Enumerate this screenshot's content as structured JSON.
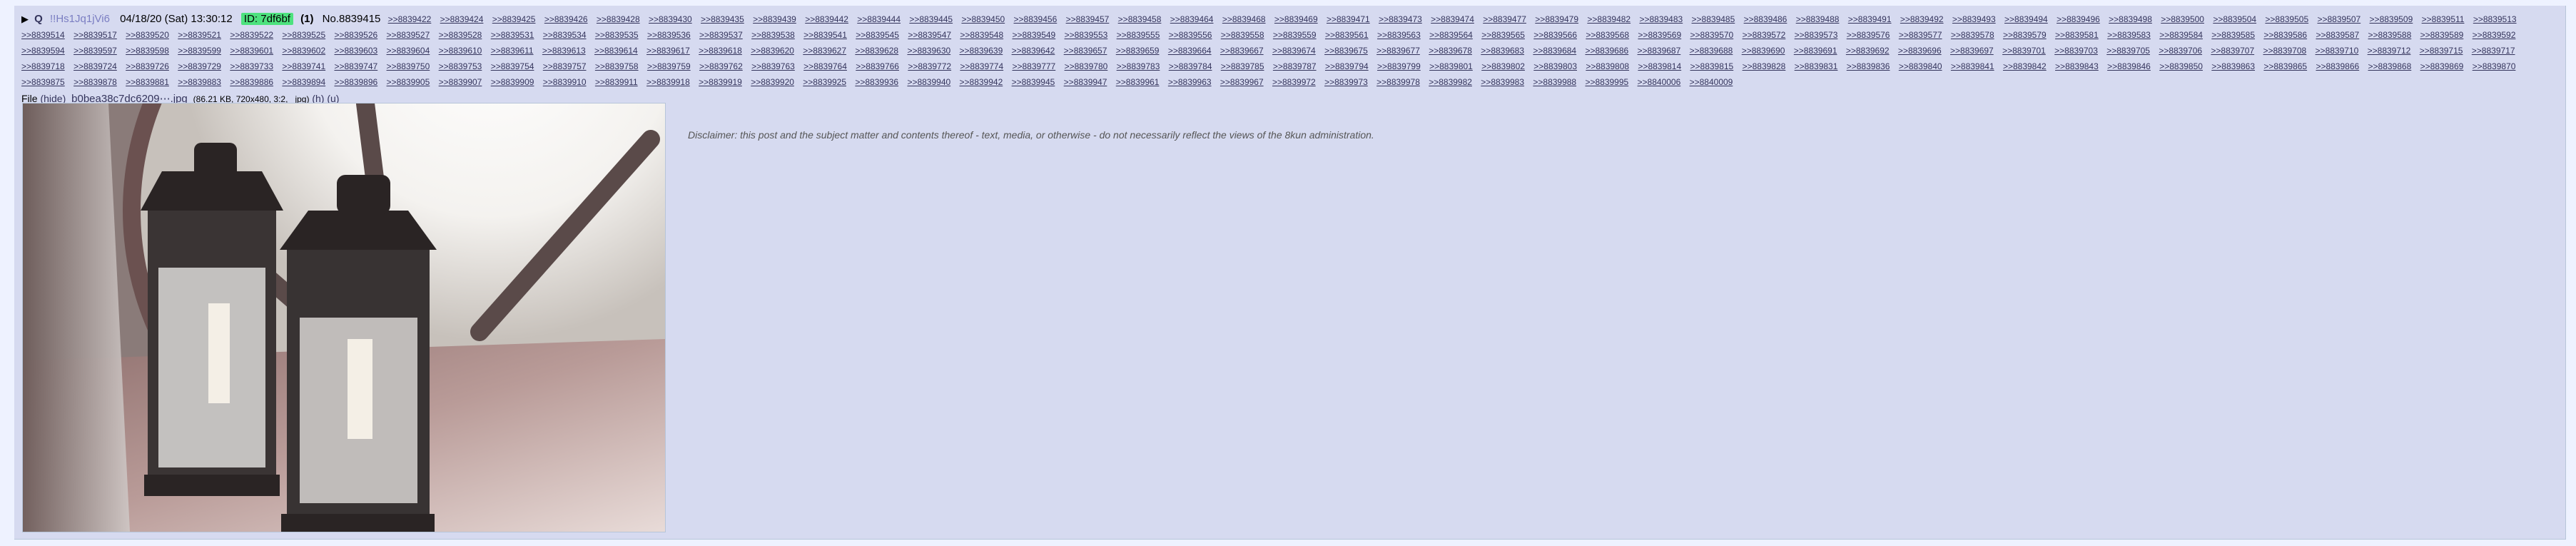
{
  "post": {
    "anchor": "Q",
    "tripcode": "!!Hs1Jq1jVi6",
    "date": "04/18/20 (Sat) 13:30:12",
    "id_label": "ID: 7df6bf",
    "post_count": "(1)",
    "post_no": "No.8839415",
    "replies": [
      ">>8839422",
      ">>8839424",
      ">>8839425",
      ">>8839426",
      ">>8839428",
      ">>8839430",
      ">>8839435",
      ">>8839439",
      ">>8839442",
      ">>8839444",
      ">>8839445",
      ">>8839450",
      ">>8839456",
      ">>8839457",
      ">>8839458",
      ">>8839464",
      ">>8839468",
      ">>8839469",
      ">>8839471",
      ">>8839473",
      ">>8839474",
      ">>8839477",
      ">>8839479",
      ">>8839482",
      ">>8839483",
      ">>8839485",
      ">>8839486",
      ">>8839488",
      ">>8839491",
      ">>8839492",
      ">>8839493",
      ">>8839494",
      ">>8839496",
      ">>8839498",
      ">>8839500",
      ">>8839504",
      ">>8839505",
      ">>8839507",
      ">>8839509",
      ">>8839511",
      ">>8839513",
      ">>8839514",
      ">>8839517",
      ">>8839520",
      ">>8839521",
      ">>8839522",
      ">>8839525",
      ">>8839526",
      ">>8839527",
      ">>8839528",
      ">>8839531",
      ">>8839534",
      ">>8839535",
      ">>8839536",
      ">>8839537",
      ">>8839538",
      ">>8839541",
      ">>8839545",
      ">>8839547",
      ">>8839548",
      ">>8839549",
      ">>8839553",
      ">>8839555",
      ">>8839556",
      ">>8839558",
      ">>8839559",
      ">>8839561",
      ">>8839563",
      ">>8839564",
      ">>8839565",
      ">>8839566",
      ">>8839568",
      ">>8839569",
      ">>8839570",
      ">>8839572",
      ">>8839573",
      ">>8839576",
      ">>8839577",
      ">>8839578",
      ">>8839579",
      ">>8839581",
      ">>8839583",
      ">>8839584",
      ">>8839585",
      ">>8839586",
      ">>8839587",
      ">>8839588",
      ">>8839589",
      ">>8839592",
      ">>8839594",
      ">>8839597",
      ">>8839598",
      ">>8839599",
      ">>8839601",
      ">>8839602",
      ">>8839603",
      ">>8839604",
      ">>8839610",
      ">>8839611",
      ">>8839613",
      ">>8839614",
      ">>8839617",
      ">>8839618",
      ">>8839620",
      ">>8839627",
      ">>8839628",
      ">>8839630",
      ">>8839639",
      ">>8839642",
      ">>8839657",
      ">>8839659",
      ">>8839664",
      ">>8839667",
      ">>8839674",
      ">>8839675",
      ">>8839677",
      ">>8839678",
      ">>8839683",
      ">>8839684",
      ">>8839686",
      ">>8839687",
      ">>8839688",
      ">>8839690",
      ">>8839691",
      ">>8839692",
      ">>8839696",
      ">>8839697",
      ">>8839701",
      ">>8839703",
      ">>8839705",
      ">>8839706",
      ">>8839707",
      ">>8839708",
      ">>8839710",
      ">>8839712",
      ">>8839715",
      ">>8839717",
      ">>8839718",
      ">>8839724",
      ">>8839726",
      ">>8839729",
      ">>8839733",
      ">>8839741",
      ">>8839747",
      ">>8839750",
      ">>8839753",
      ">>8839754",
      ">>8839757",
      ">>8839758",
      ">>8839759",
      ">>8839762",
      ">>8839763",
      ">>8839764",
      ">>8839766",
      ">>8839772",
      ">>8839774",
      ">>8839777",
      ">>8839780",
      ">>8839783",
      ">>8839784",
      ">>8839785",
      ">>8839787",
      ">>8839794",
      ">>8839799",
      ">>8839801",
      ">>8839802",
      ">>8839803",
      ">>8839808",
      ">>8839814",
      ">>8839815",
      ">>8839828",
      ">>8839831",
      ">>8839836",
      ">>8839840",
      ">>8839841",
      ">>8839842",
      ">>8839843",
      ">>8839846",
      ">>8839850",
      ">>8839863",
      ">>8839865",
      ">>8839866",
      ">>8839868",
      ">>8839869",
      ">>8839870",
      ">>8839875",
      ">>8839878",
      ">>8839881",
      ">>8839883",
      ">>8839886",
      ">>8839894",
      ">>8839896",
      ">>8839905",
      ">>8839907",
      ">>8839909",
      ">>8839910",
      ">>8839911",
      ">>8839918",
      ">>8839919",
      ">>8839920",
      ">>8839925",
      ">>8839936",
      ">>8839940",
      ">>8839942",
      ">>8839945",
      ">>8839947",
      ">>8839961",
      ">>8839963",
      ">>8839967",
      ">>8839972",
      ">>8839973",
      ">>8839978",
      ">>8839982",
      ">>8839983",
      ">>8839988",
      ">>8839995",
      ">>8840006",
      ">>8840009"
    ],
    "file": {
      "label": "File",
      "hide": "(hide)",
      "filename": "b0bea38c7dc6209⋯.jpg",
      "meta": "(86.21 KB, 720x480, 3:2, _jpg)",
      "b": "(h)",
      "u": "(u)"
    },
    "disclaimer": "Disclaimer: this post and the subject matter and contents thereof - text, media, or otherwise - do not necessarily reflect the views of the 8kun administration."
  }
}
